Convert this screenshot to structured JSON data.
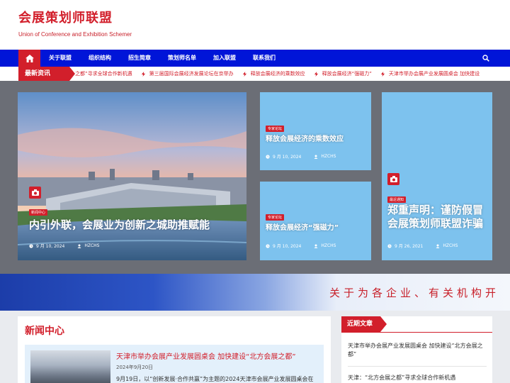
{
  "header": {
    "title": "会展策划师联盟",
    "tagline": "Union of Conference and Exhibition Schemer"
  },
  "nav": {
    "home_icon": "home-icon",
    "search_icon": "search-icon",
    "items": [
      {
        "label": "关于联盟"
      },
      {
        "label": "组织结构"
      },
      {
        "label": "招生简章"
      },
      {
        "label": "策划师名单"
      },
      {
        "label": "加入联盟"
      },
      {
        "label": "联系我们"
      }
    ]
  },
  "ticker": {
    "label": "最新资讯",
    "items": [
      {
        "text": "之都”寻求全球合作新机遇"
      },
      {
        "text": "第三届国际会展经济发展论坛在京举办"
      },
      {
        "text": "释放会展经济的乘数效应"
      },
      {
        "text": "释放会展经济“强磁力”"
      },
      {
        "text": "天津市举办会展产业发展圆桌会 加快建设"
      }
    ]
  },
  "hero": {
    "main": {
      "category": "新闻中心",
      "title": "内引外联，会展业为创新之城助推赋能",
      "date": "9 月 10, 2024",
      "author": "HZCHS"
    },
    "side1": {
      "category": "专家论坛",
      "title": "释放会展经济的乘数效应",
      "date": "9 月 10, 2024",
      "author": "HZCHS"
    },
    "side2": {
      "category": "专家论坛",
      "title": "释放会展经济“强磁力”",
      "date": "9 月 10, 2024",
      "author": "HZCHS"
    },
    "tall": {
      "category": "最近通知",
      "title": "郑重声明：谨防假冒会展策划师联盟诈骗",
      "date": "9 月 26, 2021",
      "author": "HZCHS"
    }
  },
  "banner": {
    "text": "关于为各企业、有关机构开"
  },
  "news": {
    "heading": "新闻中心",
    "item": {
      "title": "天津市举办会展产业发展圆桌会 加快建设“北方会展之都”",
      "date": "2024年9月20日",
      "excerpt": "9月19日，以“创新发展·合作共赢”为主题的2024天津市会展产业发展圆桌会在"
    }
  },
  "recent": {
    "label": "近期文章",
    "items": [
      {
        "text": "天津市举办会展产业发展圆桌会 加快建设“北方会展之都”"
      },
      {
        "text": "天津：“北方会展之都”寻求全球合作新机遇"
      }
    ]
  },
  "colors": {
    "brand_red": "#d21f2b",
    "nav_blue": "#0015d8",
    "card_blue": "#7dc2ee"
  }
}
